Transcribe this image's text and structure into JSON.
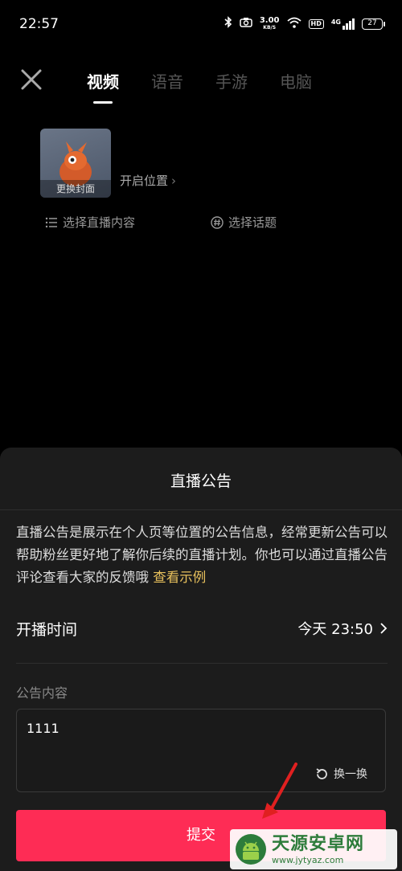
{
  "status_bar": {
    "time": "22:57",
    "speed_value": "3.00",
    "speed_unit": "KB/S",
    "hd": "HD",
    "network": "4G",
    "battery": "27"
  },
  "nav": {
    "tabs": [
      {
        "label": "视频",
        "active": true
      },
      {
        "label": "语音",
        "active": false
      },
      {
        "label": "手游",
        "active": false
      },
      {
        "label": "电脑",
        "active": false
      }
    ]
  },
  "setup": {
    "cover_label": "更换封面",
    "location_label": "开启位置",
    "content_option": "选择直播内容",
    "topic_option": "选择话题"
  },
  "sheet": {
    "title": "直播公告",
    "description": "直播公告是展示在个人页等位置的公告信息，经常更新公告可以帮助粉丝更好地了解你后续的直播计划。你也可以通过直播公告评论查看大家的反馈哦",
    "example_link": "查看示例",
    "start_time_label": "开播时间",
    "start_time_value": "今天 23:50",
    "content_label": "公告内容",
    "content_value": "1111",
    "swap_label": "换一换",
    "submit_label": "提交"
  },
  "watermark": {
    "name": "天源安卓网",
    "url": "www.jytyaz.com"
  },
  "colors": {
    "accent": "#fe2c55",
    "link": "#e8c15d",
    "sheet_bg": "#1c1c1c",
    "annotation_arrow": "#e02020"
  }
}
